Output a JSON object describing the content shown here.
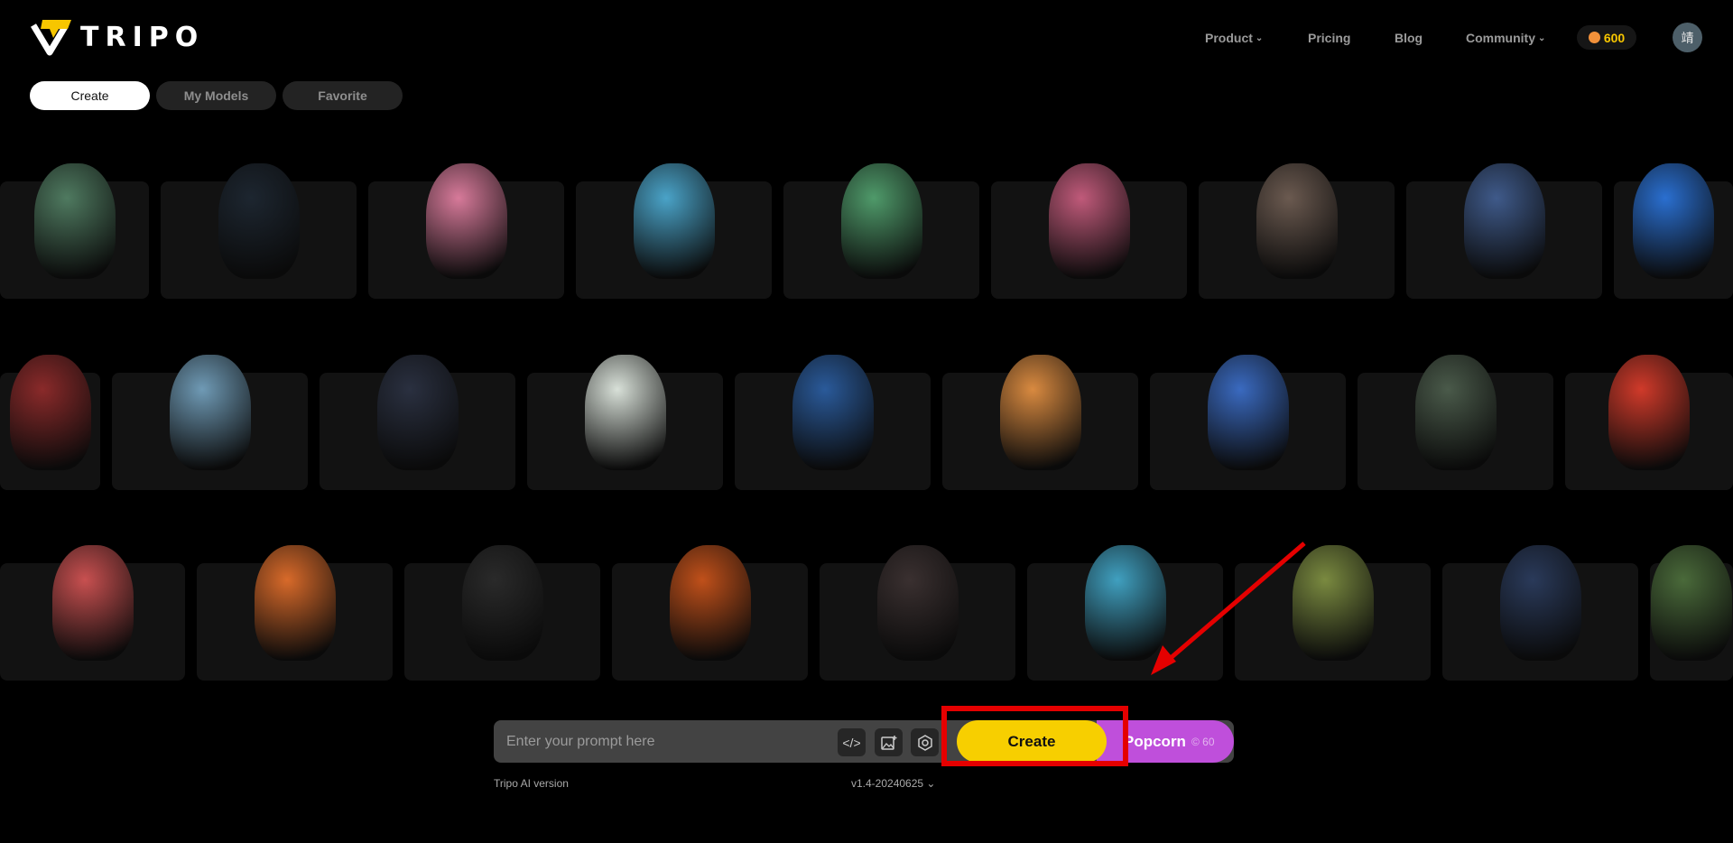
{
  "header": {
    "brand": "TRIPO",
    "nav": [
      {
        "label": "Product",
        "has_dropdown": true
      },
      {
        "label": "Pricing",
        "has_dropdown": false
      },
      {
        "label": "Blog",
        "has_dropdown": false
      },
      {
        "label": "Community",
        "has_dropdown": true
      }
    ],
    "credits": "600",
    "avatar_initial": "靖"
  },
  "tabs": [
    {
      "label": "Create",
      "active": true
    },
    {
      "label": "My Models",
      "active": false
    },
    {
      "label": "Favorite",
      "active": false
    }
  ],
  "gallery": {
    "rows": [
      [
        "#4f7a60",
        "#1d2630",
        "#d77a9a",
        "#4aa3c8",
        "#4f9a6a",
        "#c05a7a",
        "#6b5a50",
        "#3f5a8a",
        "#2a6fd0"
      ],
      [
        "#8a2a2a",
        "#6f9ab5",
        "#2a3040",
        "#d8e0d8",
        "#2a5a9a",
        "#d98a40",
        "#3a6ac0",
        "#4a5a4a",
        "#d03a2a"
      ],
      [
        "#c85050",
        "#d86a2a",
        "#2a2a2a",
        "#c0501a",
        "#3a3030",
        "#40a0c0",
        "#7a8a40",
        "#2a3a5a",
        "#4a6a3a"
      ]
    ]
  },
  "prompt": {
    "placeholder": "Enter your prompt here",
    "value": "",
    "tools": [
      "code-icon",
      "image-add-icon",
      "settings-hex-icon"
    ],
    "create_label": "Create",
    "popcorn_label": "Popcorn",
    "popcorn_cost": "60",
    "version_label": "Tripo AI version",
    "version_value": "v1.4-20240625"
  },
  "colors": {
    "accent": "#f7cf00",
    "popcorn": "#bf4fdb",
    "annotation": "#e50000"
  }
}
